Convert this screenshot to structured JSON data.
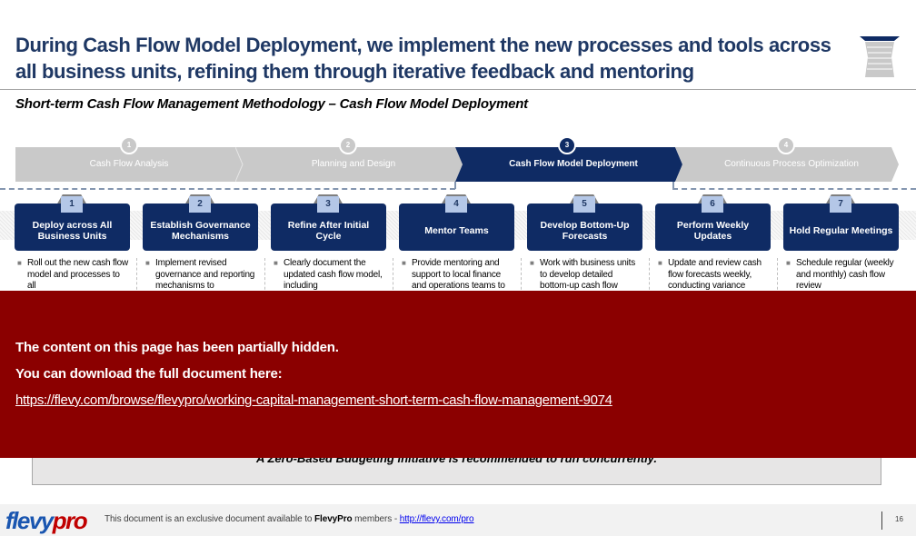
{
  "header": {
    "title": "During Cash Flow Model Deployment, we implement the new processes and tools across all business units, refining them through iterative feedback and mentoring",
    "subtitle": "Short-term Cash Flow Management Methodology – Cash Flow Model Deployment",
    "icon": "hourglass-stack-icon"
  },
  "phases": [
    {
      "number": "1",
      "label": "Cash Flow Analysis",
      "active": false
    },
    {
      "number": "2",
      "label": "Planning and Design",
      "active": false
    },
    {
      "number": "3",
      "label": "Cash Flow Model Deployment",
      "active": true
    },
    {
      "number": "4",
      "label": "Continuous Process Optimization",
      "active": false
    }
  ],
  "steps": [
    {
      "number": "1",
      "title": "Deploy across All Business Units",
      "bullet": "Roll out the new cash flow model and processes to all"
    },
    {
      "number": "2",
      "title": "Establish Governance Mechanisms",
      "bullet": "Implement revised governance and reporting mechanisms to"
    },
    {
      "number": "3",
      "title": "Refine After Initial Cycle",
      "bullet": "Clearly document the updated cash flow model, including"
    },
    {
      "number": "4",
      "title": "Mentor Teams",
      "bullet": "Provide mentoring and support to local finance and operations teams to"
    },
    {
      "number": "5",
      "title": "Develop Bottom-Up Forecasts",
      "bullet": "Work with business units to develop detailed bottom-up cash flow"
    },
    {
      "number": "6",
      "title": "Perform Weekly Updates",
      "bullet": "Update and review cash flow forecasts weekly, conducting variance"
    },
    {
      "number": "7",
      "title": "Hold Regular Meetings",
      "bullet": "Schedule regular (weekly and monthly) cash flow review"
    }
  ],
  "note": "A Zero-Based Budgeting initiative is recommended to run concurrently.",
  "overlay": {
    "line1": "The content on this page has been partially hidden.",
    "line2": "You can download the full document here:",
    "link": "https://flevy.com/browse/flevypro/working-capital-management-short-term-cash-flow-management-9074"
  },
  "footer": {
    "logo_part1": "flevy",
    "logo_part2": "pro",
    "text_before": "This document is an exclusive document available to ",
    "text_bold": "FlevyPro",
    "text_after": " members - ",
    "link": "http://flevy.com/pro",
    "page_number": "16"
  },
  "colors": {
    "navy": "#0f2b64",
    "title_blue": "#1f3864",
    "inactive_gray": "#c9c9c9",
    "overlay_red": "#8b0000",
    "step_tab_blue": "#b4c7e7"
  }
}
